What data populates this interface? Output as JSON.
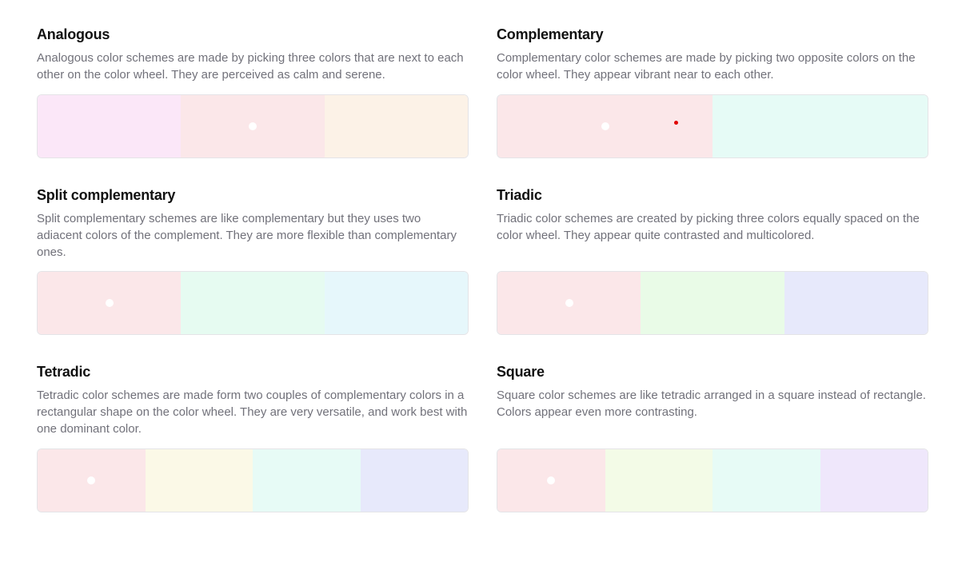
{
  "schemes": [
    {
      "id": "analogous",
      "title": "Analogous",
      "description": "Analogous color schemes are made by picking three colors that are next to each other on the color wheel. They are perceived as calm and serene.",
      "colors": [
        "#fbe7f8",
        "#fbe7e9",
        "#fcf2e7"
      ],
      "selected_index": 1
    },
    {
      "id": "complementary",
      "title": "Complementary",
      "description": "Complementary color schemes are made by picking two opposite colors on the color wheel. They appear vibrant near to each other.",
      "colors": [
        "#fbe7e9",
        "#e6fbf6"
      ],
      "selected_index": 0
    },
    {
      "id": "split-complementary",
      "title": "Split complementary",
      "description": "Split complementary schemes are like complementary but they uses two adiacent colors of the complement. They are more flexible than complementary ones.",
      "colors": [
        "#fbe7e9",
        "#e6fbf1",
        "#e6f7fb"
      ],
      "selected_index": 0
    },
    {
      "id": "triadic",
      "title": "Triadic",
      "description": "Triadic color schemes are created by picking three colors equally spaced on the color wheel. They appear quite contrasted and multicolored.",
      "colors": [
        "#fbe7e9",
        "#e9fbe7",
        "#e7e9fb"
      ],
      "selected_index": 0
    },
    {
      "id": "tetradic",
      "title": "Tetradic",
      "description": "Tetradic color schemes are made form two couples of complementary colors in a rectangular shape on the color wheel. They are very versatile, and work best with one dominant color.",
      "colors": [
        "#fbe7e9",
        "#fbf9e7",
        "#e7fbf6",
        "#e7e9fb"
      ],
      "selected_index": 0
    },
    {
      "id": "square",
      "title": "Square",
      "description": "Square color schemes are like tetradic arranged in a square instead of rectangle. Colors appear even more contrasting.",
      "colors": [
        "#fbe7e9",
        "#f3fbe7",
        "#e7fbf6",
        "#efe7fb"
      ],
      "selected_index": 0
    }
  ]
}
